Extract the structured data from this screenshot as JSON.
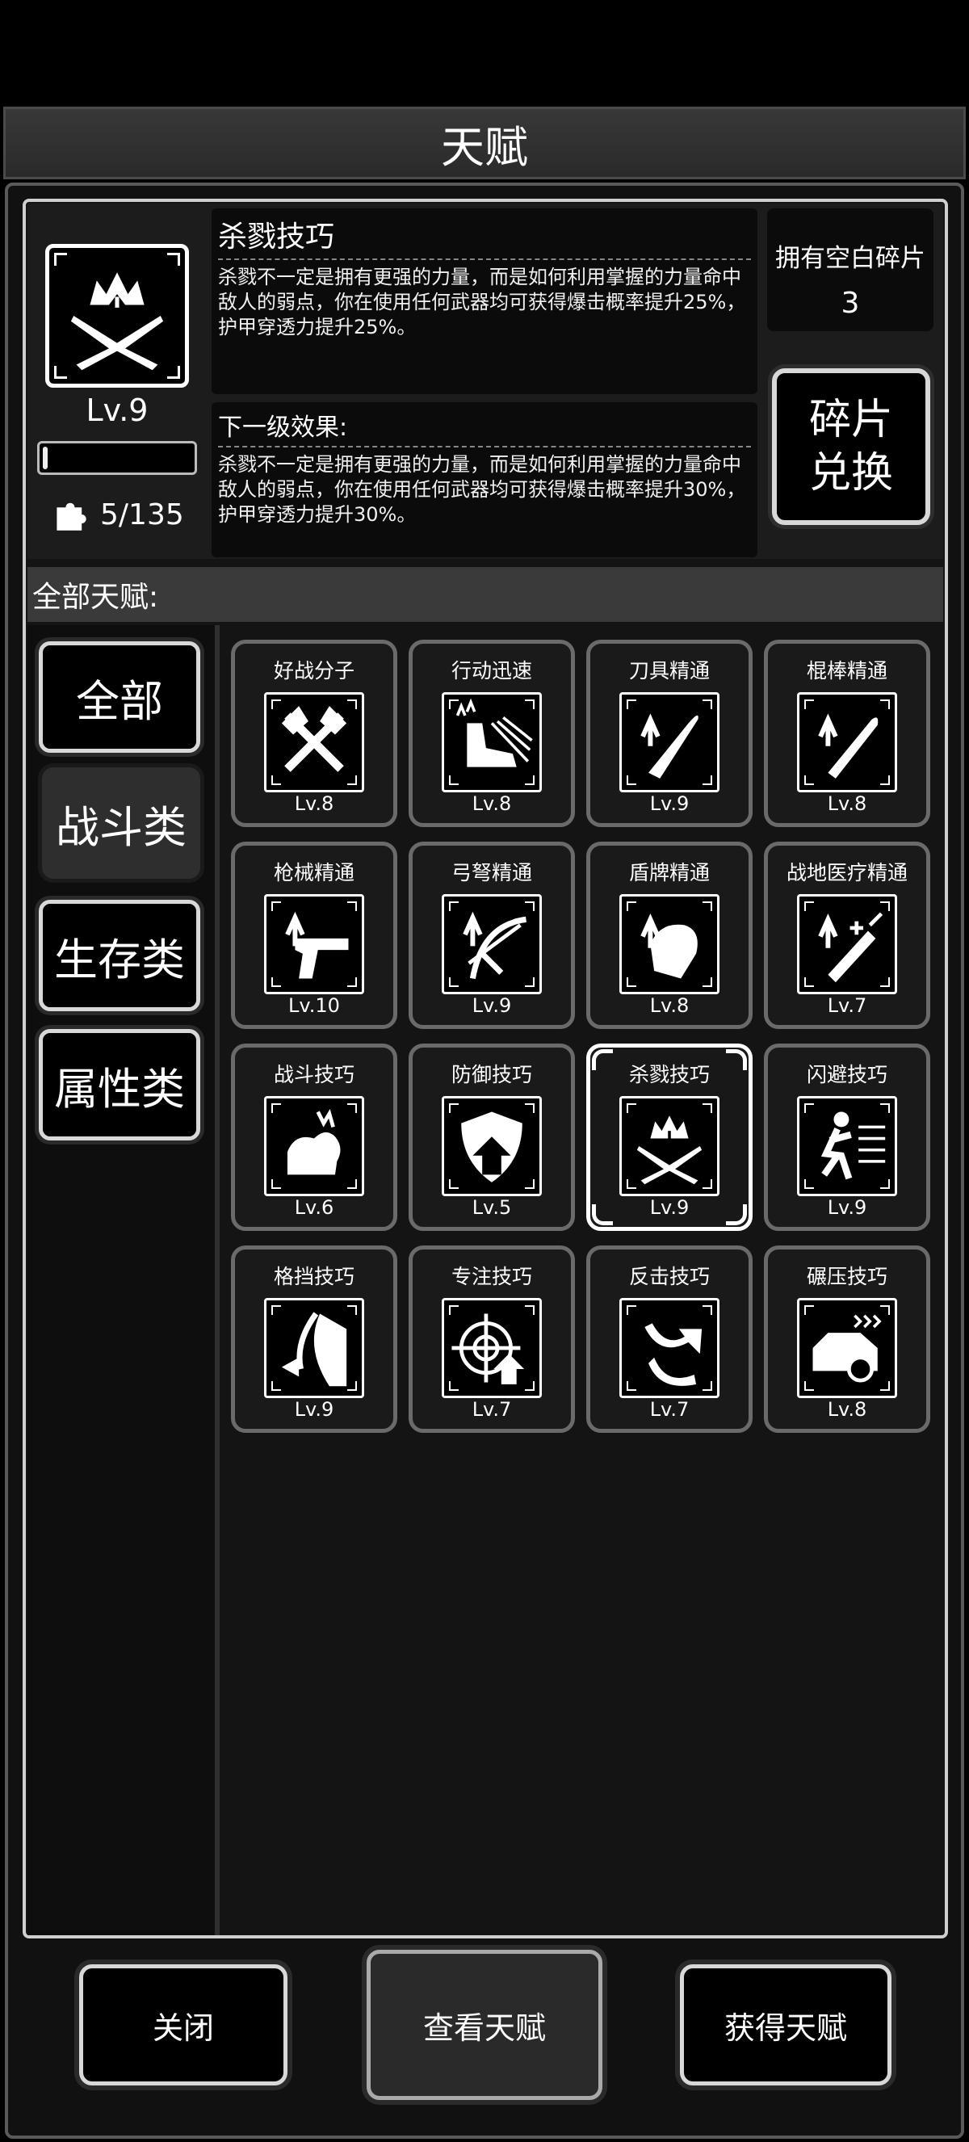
{
  "title": "天赋",
  "selected": {
    "name": "杀戮技巧",
    "level": "Lv.9",
    "progress_fraction": 0.03,
    "fragments": "5/135",
    "description": "杀戮不一定是拥有更强的力量，而是如何利用掌握的力量命中敌人的弱点，你在使用任何武器均可获得爆击概率提升25%，护甲穿透力提升25%。",
    "next_label": "下一级效果:",
    "next_description": "杀戮不一定是拥有更强的力量，而是如何利用掌握的力量命中敌人的弱点，你在使用任何武器均可获得爆击概率提升30%，护甲穿透力提升30%。"
  },
  "owned": {
    "label": "拥有空白碎片",
    "value": "3"
  },
  "exchange_button": {
    "line1": "碎片",
    "line2": "兑换"
  },
  "section_label": "全部天赋:",
  "categories": [
    {
      "label": "全部",
      "active": false
    },
    {
      "label": "战斗类",
      "active": true
    },
    {
      "label": "生存类",
      "active": false
    },
    {
      "label": "属性类",
      "active": false
    }
  ],
  "talents": [
    {
      "name": "好战分子",
      "level": "Lv.8",
      "icon": "crossed-axes-icon"
    },
    {
      "name": "行动迅速",
      "level": "Lv.8",
      "icon": "running-boot-icon"
    },
    {
      "name": "刀具精通",
      "level": "Lv.9",
      "icon": "machete-icon"
    },
    {
      "name": "棍棒精通",
      "level": "Lv.8",
      "icon": "bat-icon"
    },
    {
      "name": "枪械精通",
      "level": "Lv.10",
      "icon": "pistol-icon"
    },
    {
      "name": "弓弩精通",
      "level": "Lv.9",
      "icon": "crossbow-icon"
    },
    {
      "name": "盾牌精通",
      "level": "Lv.8",
      "icon": "shield-pad-icon"
    },
    {
      "name": "战地医疗精通",
      "level": "Lv.7",
      "icon": "syringe-icon"
    },
    {
      "name": "战斗技巧",
      "level": "Lv.6",
      "icon": "flexed-arm-icon"
    },
    {
      "name": "防御技巧",
      "level": "Lv.5",
      "icon": "shield-arrow-icon"
    },
    {
      "name": "杀戮技巧",
      "level": "Lv.9",
      "icon": "crossed-blades-crown-icon"
    },
    {
      "name": "闪避技巧",
      "level": "Lv.9",
      "icon": "dodging-man-icon"
    },
    {
      "name": "格挡技巧",
      "level": "Lv.9",
      "icon": "block-arrow-icon"
    },
    {
      "name": "专注技巧",
      "level": "Lv.7",
      "icon": "crosshair-icon"
    },
    {
      "name": "反击技巧",
      "level": "Lv.7",
      "icon": "counter-hook-icon"
    },
    {
      "name": "碾压技巧",
      "level": "Lv.8",
      "icon": "car-crash-icon"
    }
  ],
  "selected_talent_index": 10,
  "buttons": {
    "close": "关闭",
    "view": "查看天赋",
    "acquire": "获得天赋"
  }
}
